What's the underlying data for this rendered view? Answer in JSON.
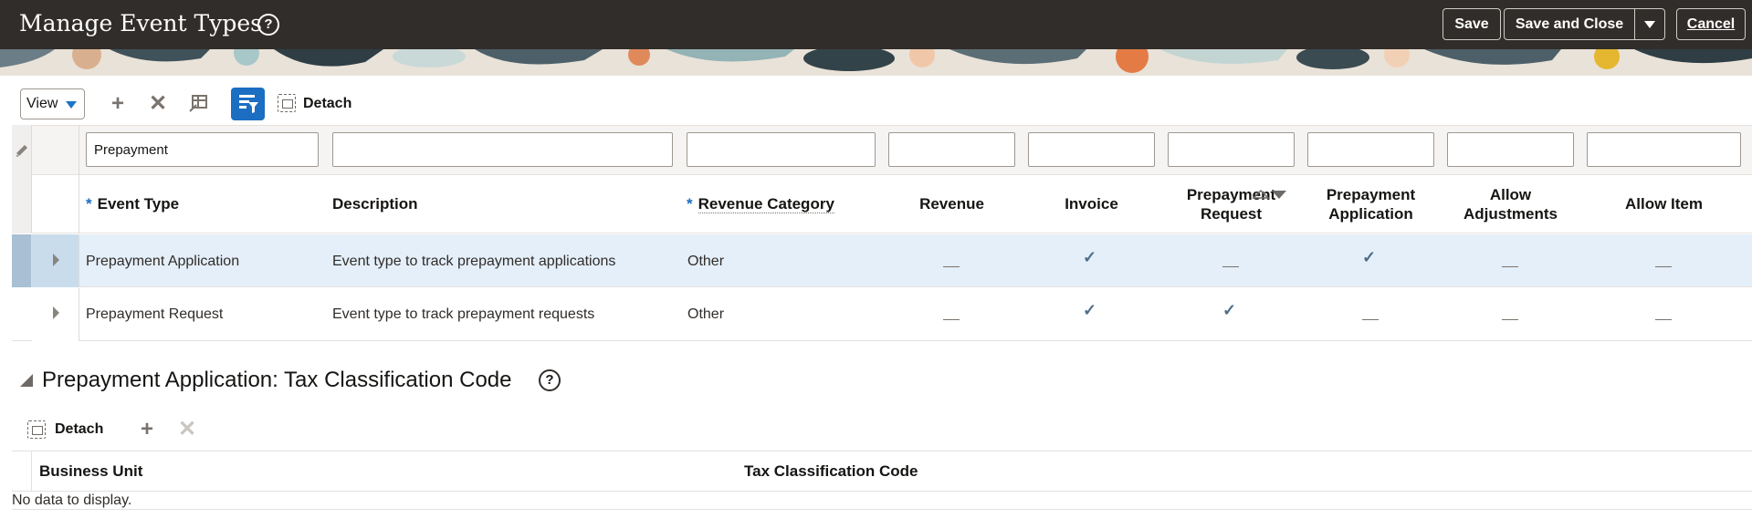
{
  "header": {
    "title": "Manage Event Types",
    "help_icon": "help-icon",
    "save_label": "Save",
    "save_close_label": "Save and Close",
    "cancel_label": "Cancel",
    "menu_icon": "chevron-down-icon"
  },
  "toolbar": {
    "view_label": "View",
    "add_icon": "plus-icon",
    "delete_icon": "close-icon",
    "freeze_icon": "freeze-icon",
    "filter_icon": "query-by-example-icon",
    "detach_label": "Detach"
  },
  "table": {
    "filters": [
      "Prepayment",
      "",
      "",
      "",
      "",
      "",
      "",
      "",
      ""
    ],
    "columns": [
      {
        "label": "Event Type",
        "required": true
      },
      {
        "label": "Description",
        "required": false
      },
      {
        "label": "Revenue Category",
        "required": true
      },
      {
        "label": "Revenue",
        "required": false
      },
      {
        "label": "Invoice",
        "required": false
      },
      {
        "label": "Prepayment Request",
        "required": false
      },
      {
        "label": "Prepayment Application",
        "required": false
      },
      {
        "label": "Allow Adjustments",
        "required": false
      },
      {
        "label": "Allow Item",
        "required": false
      }
    ],
    "required_mark": "*",
    "rows": [
      {
        "event_type": "Prepayment Application",
        "description": "Event type to track prepayment applications",
        "revenue_category": "Other",
        "revenue": false,
        "invoice": true,
        "prepayment_request": false,
        "prepayment_application": true,
        "allow_adjustments": false,
        "allow_item": false,
        "selected": true
      },
      {
        "event_type": "Prepayment Request",
        "description": "Event type to track prepayment requests",
        "revenue_category": "Other",
        "revenue": false,
        "invoice": true,
        "prepayment_request": true,
        "prepayment_application": false,
        "allow_adjustments": false,
        "allow_item": false,
        "selected": false
      }
    ],
    "check_glyph": "✓"
  },
  "detail": {
    "title": "Prepayment Application: Tax Classification Code",
    "detach_label": "Detach",
    "columns": [
      "Business Unit",
      "Tax Classification Code"
    ],
    "empty_text": "No data to display."
  },
  "colors": {
    "header_bg": "#312d2a",
    "accent": "#1b6ec2",
    "selected_row": "#e4eff9"
  }
}
